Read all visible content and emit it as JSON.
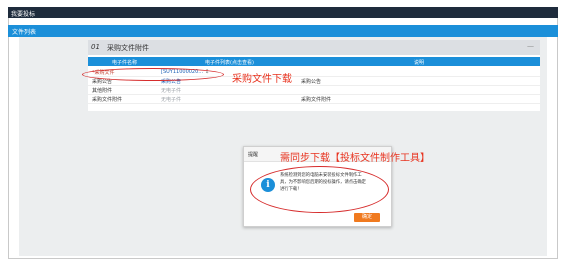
{
  "window": {
    "title": "我要投标"
  },
  "list_bar": {
    "title": "文件列表"
  },
  "panel": {
    "number": "01",
    "title": "采购文件附件",
    "collapse": "—",
    "columns": [
      "电子件名称",
      "电子件列表(点击查看)",
      "说明"
    ],
    "rows": [
      {
        "name": "*采购文件",
        "file": "[SUY11000020…",
        "note": "",
        "download_icon": "download-icon"
      },
      {
        "name": "采购公告",
        "file": "采购公告",
        "note": "采购公告"
      },
      {
        "name": "其他附件",
        "file": "无电子件",
        "note": ""
      },
      {
        "name": "采购文件附件",
        "file": "无电子件",
        "note": "采购文件附件"
      }
    ]
  },
  "annotations": {
    "download": "采购文件下载",
    "tool": "需同步下载【投标文件制作工具】"
  },
  "dialog": {
    "title": "提醒",
    "icon": "info-icon",
    "message_lines": [
      "系统检测到您的电脑未安装投标文件制作工",
      "具，为不影响您后期的投标操作，请点击确定",
      "进行下载！"
    ],
    "ok_label": "确定"
  },
  "colors": {
    "titlebar": "#1e2b3c",
    "accent": "#1b8fd9",
    "annotation": "#e8331f",
    "button": "#f07a1f"
  }
}
